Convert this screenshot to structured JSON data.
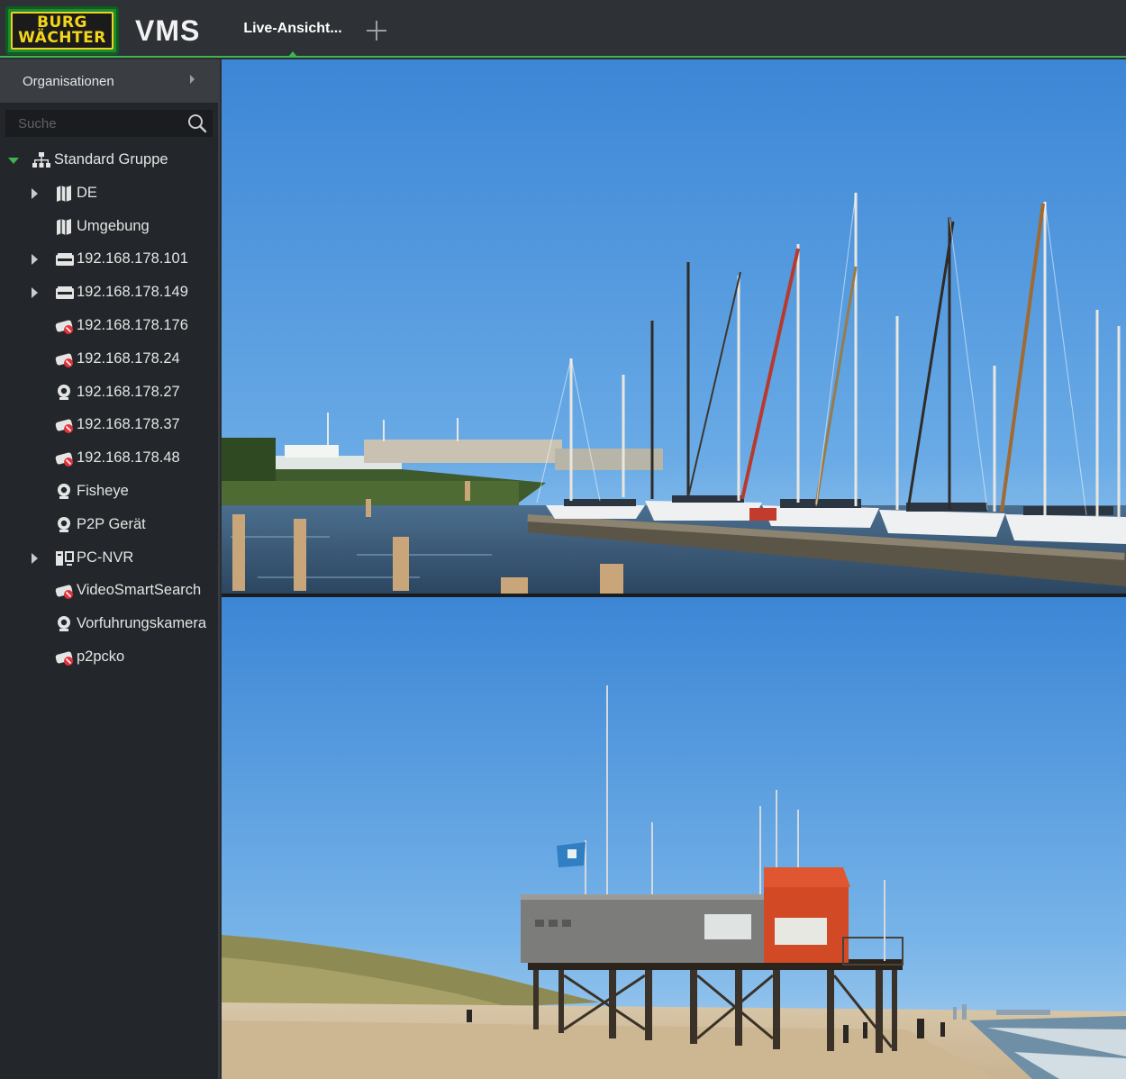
{
  "header": {
    "logo_line1": "BURG",
    "logo_line2": "WÄCHTER",
    "app_title": "VMS",
    "active_tab": "Live-Ansicht...",
    "accent": "#3fb34f"
  },
  "sidebar": {
    "organizations_label": "Organisationen",
    "search_placeholder": "Suche",
    "tree": [
      {
        "label": "Standard Gruppe",
        "icon": "group-tree-icon",
        "expanded": true
      },
      {
        "label": "DE",
        "icon": "map-icon",
        "expandable": true
      },
      {
        "label": "Umgebung",
        "icon": "map-icon"
      },
      {
        "label": "192.168.178.101",
        "icon": "nvr-device-icon",
        "expandable": true
      },
      {
        "label": "192.168.178.149",
        "icon": "nvr-device-icon",
        "expandable": true
      },
      {
        "label": "192.168.178.176",
        "icon": "camera-offline-icon"
      },
      {
        "label": "192.168.178.24",
        "icon": "camera-offline-icon"
      },
      {
        "label": "192.168.178.27",
        "icon": "webcam-icon"
      },
      {
        "label": "192.168.178.37",
        "icon": "camera-offline-icon"
      },
      {
        "label": "192.168.178.48",
        "icon": "camera-offline-icon"
      },
      {
        "label": "Fisheye",
        "icon": "webcam-icon"
      },
      {
        "label": "P2P Gerät",
        "icon": "webcam-icon"
      },
      {
        "label": "PC-NVR",
        "icon": "pc-nvr-icon",
        "expandable": true
      },
      {
        "label": "VideoSmartSearch",
        "icon": "camera-offline-icon"
      },
      {
        "label": "Vorfuhrungskamera",
        "icon": "webcam-icon"
      },
      {
        "label": "p2pcko",
        "icon": "camera-offline-icon"
      }
    ]
  },
  "video": {
    "panes": [
      {
        "scene": "marina with sailboats"
      },
      {
        "scene": "beach with lifeguard station on stilts"
      }
    ]
  }
}
